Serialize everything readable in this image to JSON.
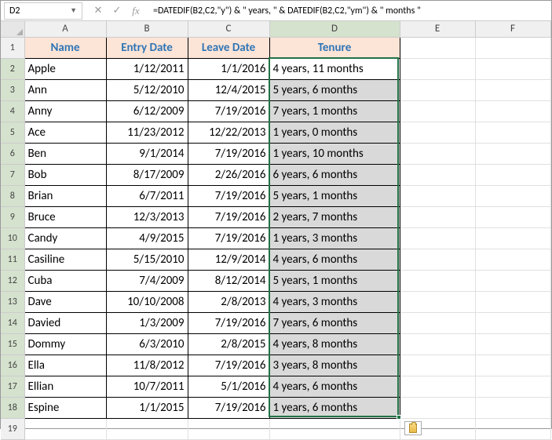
{
  "nameBox": "D2",
  "formula": "=DATEDIF(B2,C2,\"y\") & \" years, \" & DATEDIF(B2,C2,\"ym\") & \" months \"",
  "columns": [
    "A",
    "B",
    "C",
    "D",
    "E",
    "F"
  ],
  "headers": {
    "A": "Name",
    "B": "Entry Date",
    "C": "Leave Date",
    "D": "Tenure"
  },
  "chart_data": {
    "type": "table",
    "title": "Tenure",
    "columns": [
      "Name",
      "Entry Date",
      "Leave Date",
      "Tenure"
    ],
    "rows": [
      {
        "name": "Apple",
        "entry": "1/12/2011",
        "leave": "1/1/2016",
        "tenure": "4 years, 11 months"
      },
      {
        "name": "Ann",
        "entry": "5/12/2010",
        "leave": "12/4/2015",
        "tenure": "5 years, 6 months"
      },
      {
        "name": "Anny",
        "entry": "6/12/2009",
        "leave": "7/19/2016",
        "tenure": "7 years, 1 months"
      },
      {
        "name": "Ace",
        "entry": "11/23/2012",
        "leave": "12/22/2013",
        "tenure": "1 years, 0 months"
      },
      {
        "name": "Ben",
        "entry": "9/1/2014",
        "leave": "7/19/2016",
        "tenure": "1 years, 10 months"
      },
      {
        "name": "Bob",
        "entry": "8/17/2009",
        "leave": "2/26/2016",
        "tenure": "6 years, 6 months"
      },
      {
        "name": "Brian",
        "entry": "6/7/2011",
        "leave": "7/19/2016",
        "tenure": "5 years, 1 months"
      },
      {
        "name": "Bruce",
        "entry": "12/3/2013",
        "leave": "7/19/2016",
        "tenure": "2 years, 7 months"
      },
      {
        "name": "Candy",
        "entry": "4/9/2015",
        "leave": "7/19/2016",
        "tenure": "1 years, 3 months"
      },
      {
        "name": "Casiline",
        "entry": "5/15/2010",
        "leave": "12/9/2014",
        "tenure": "4 years, 6 months"
      },
      {
        "name": "Cuba",
        "entry": "7/4/2009",
        "leave": "8/12/2014",
        "tenure": "5 years, 1 months"
      },
      {
        "name": "Dave",
        "entry": "10/10/2008",
        "leave": "2/8/2013",
        "tenure": "4 years, 3 months"
      },
      {
        "name": "Davied",
        "entry": "1/3/2009",
        "leave": "7/19/2016",
        "tenure": "7 years, 6 months"
      },
      {
        "name": "Dommy",
        "entry": "6/3/2010",
        "leave": "2/8/2015",
        "tenure": "4 years, 8 months"
      },
      {
        "name": "Ella",
        "entry": "11/8/2012",
        "leave": "7/19/2016",
        "tenure": "3 years, 8 months"
      },
      {
        "name": "Ellian",
        "entry": "10/7/2011",
        "leave": "5/1/2016",
        "tenure": "4 years, 6 months"
      },
      {
        "name": "Espine",
        "entry": "1/1/2015",
        "leave": "7/19/2016",
        "tenure": "1 years, 6 months"
      }
    ]
  },
  "lastRowLabel": "19",
  "activeCell": "D2",
  "selectedColumn": "D"
}
